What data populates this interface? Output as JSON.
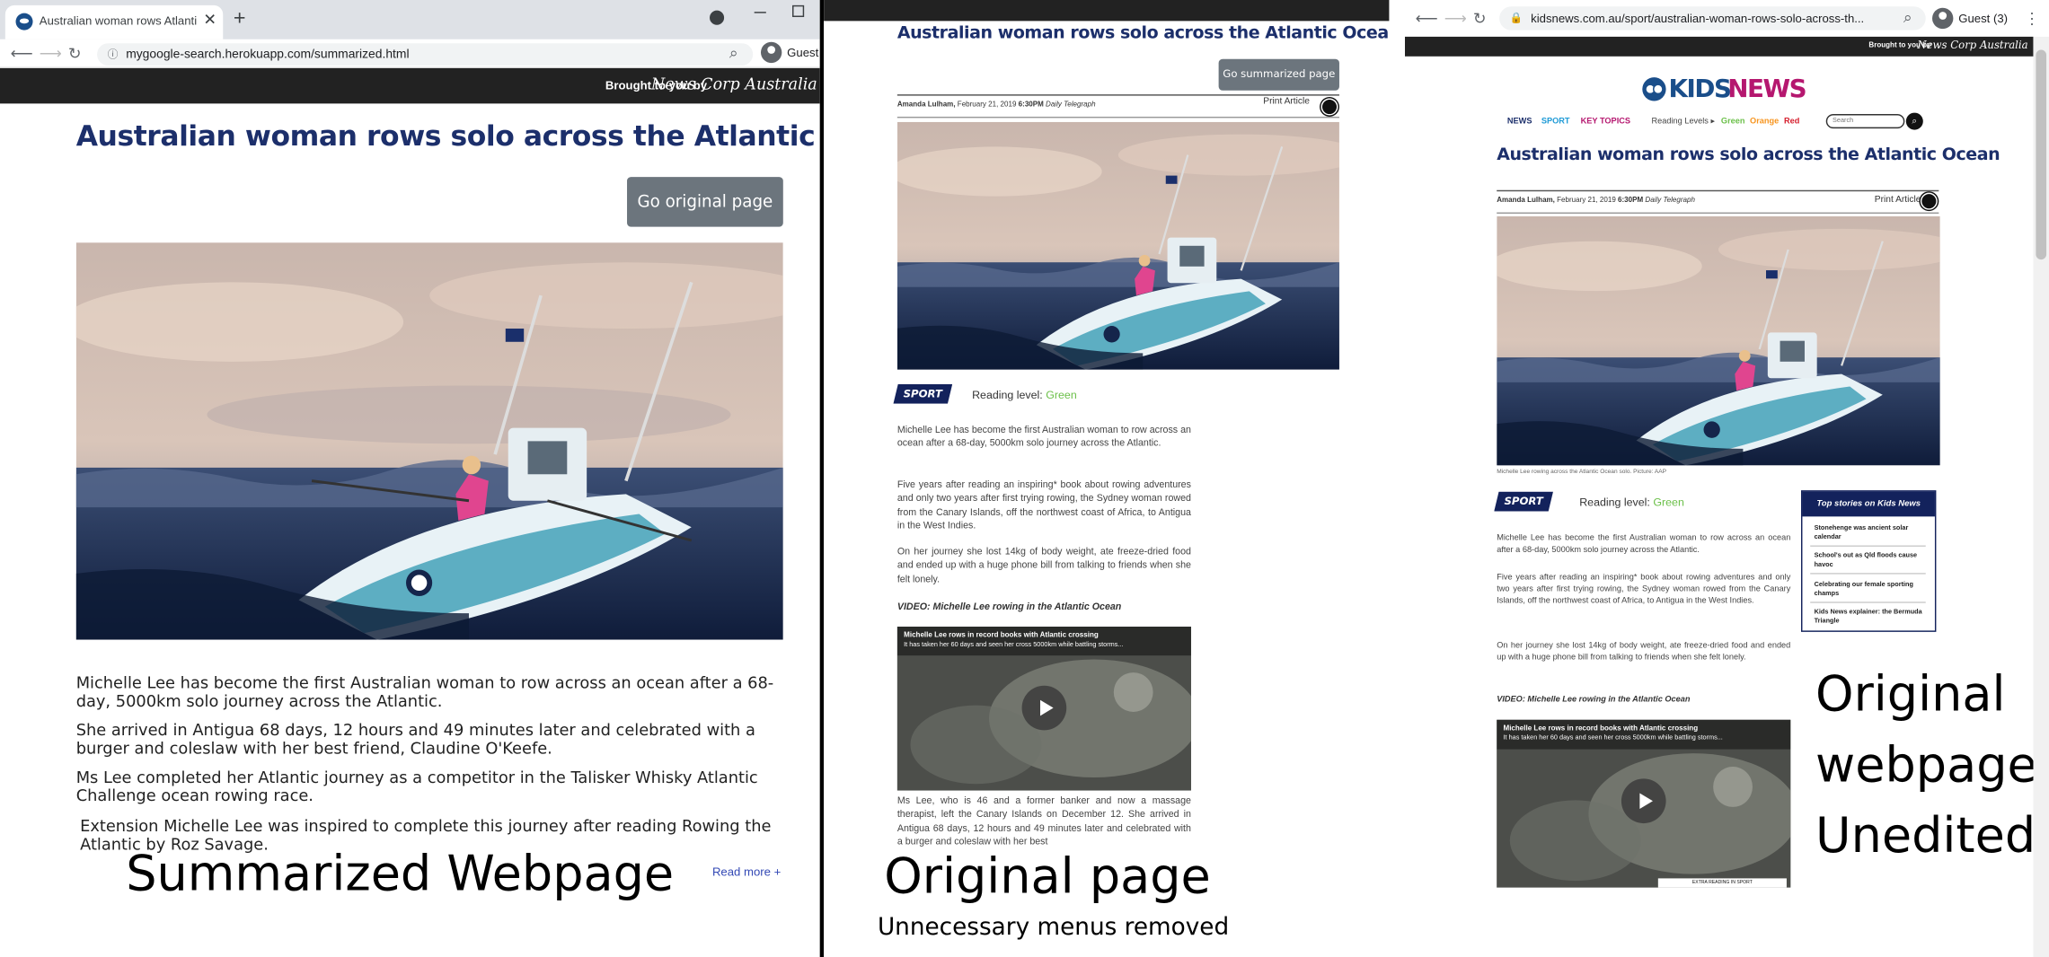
{
  "panel1": {
    "tab_title": "Australian woman rows Atlantic |",
    "tab_close": "✕",
    "new_tab": "+",
    "url": "mygoogle-search.herokuapp.com/summarized.html",
    "profile": "Guest",
    "brought_to_you": "Brought to you by",
    "brand_logo": "News Corp Australia",
    "headline": "Australian woman rows solo across the Atlantic Ocean",
    "button": "Go original page",
    "paragraphs": [
      "Michelle Lee has become the first Australian woman to row across an ocean after a 68-day, 5000km solo journey across the Atlantic.",
      "She arrived in Antigua 68 days, 12 hours and 49 minutes later and celebrated with a burger and coleslaw with her best friend, Claudine O'Keefe.",
      "Ms Lee completed her Atlantic journey as a competitor in the Talisker Whisky Atlantic Challenge ocean rowing race.",
      "Extension Michelle Lee was inspired to complete this journey after reading Rowing the Atlantic by Roz Savage."
    ],
    "read_more": "Read more +",
    "label": "Summarized Webpage"
  },
  "panel2": {
    "headline": "Australian woman rows solo across the Atlantic Ocean",
    "button": "Go summarized page",
    "author": "Amanda Lulham,",
    "date": "February 21, 2019",
    "time": "6:30PM",
    "publication": "Daily Telegraph",
    "print": "Print Article",
    "category": "SPORT",
    "reading_level_label": "Reading level:",
    "reading_level": "Green",
    "paragraphs": [
      "Michelle Lee has become the first Australian woman to row across an ocean after a 68-day, 5000km solo journey across the Atlantic.",
      "Five years after reading an inspiring* book about rowing adventures and only two years after first trying rowing, the Sydney woman rowed from the Canary Islands, off the northwest coast of Africa, to Antigua in the West Indies.",
      "On her journey she lost 14kg of body weight, ate freeze-dried food and ended up with a huge phone bill from talking to friends when she felt lonely."
    ],
    "video_heading": "VIDEO: Michelle Lee rowing in the Atlantic Ocean",
    "video_title": "Michelle Lee rows in record books with Atlantic crossing",
    "video_sub": "It has taken her 60 days and seen her cross 5000km while battling storms...",
    "after_video": "Ms Lee, who is 46 and a former banker and now a massage therapist, left the Canary Islands on December 12. She arrived in Antigua 68 days, 12 hours and 49 minutes later and celebrated with a burger and coleslaw with her best",
    "label": "Original page",
    "sublabel": "Unnecessary menus removed"
  },
  "panel3": {
    "url": "kidsnews.com.au/sport/australian-woman-rows-solo-across-th...",
    "profile": "Guest (3)",
    "brought_to_you": "Brought to you by",
    "brand_logo": "News Corp Australia",
    "logo_kids": "KIDS",
    "logo_news": "NEWS",
    "nav": [
      "NEWS",
      "SPORT",
      "KEY TOPICS"
    ],
    "reading_levels_label": "Reading Levels ▸",
    "levels": [
      "Green",
      "Orange",
      "Red"
    ],
    "search_placeholder": "Search",
    "headline": "Australian woman rows solo across the Atlantic Ocean",
    "author": "Amanda Lulham,",
    "date": "February 21, 2019",
    "time": "6:30PM",
    "publication": "Daily Telegraph",
    "print": "Print Article",
    "photo_caption": "Michelle Lee rowing across the Atlantic Ocean solo. Picture: AAP",
    "category": "SPORT",
    "reading_level_label": "Reading level:",
    "reading_level": "Green",
    "paragraphs": [
      "Michelle Lee has become the first Australian woman to row across an ocean after a 68-day, 5000km solo journey across the Atlantic.",
      "Five years after reading an inspiring* book about rowing adventures and only two years after first trying rowing, the Sydney woman rowed from the Canary Islands, off the northwest coast of Africa, to Antigua in the West Indies.",
      "On her journey she lost 14kg of body weight, ate freeze-dried food and ended up with a huge phone bill from talking to friends when she felt lonely."
    ],
    "video_heading": "VIDEO: Michelle Lee rowing in the Atlantic Ocean",
    "video_title": "Michelle Lee rows in record books with Atlantic crossing",
    "video_sub": "It has taken her 60 days and seen her cross 5000km while battling storms...",
    "video_footer": "EXTRA READING IN SPORT",
    "top_stories_title": "Top stories on Kids News",
    "top_stories": [
      "Stonehenge was ancient solar calendar",
      "School's out as Qld floods cause havoc",
      "Celebrating our female sporting champs",
      "Kids News explainer: the Bermuda Triangle"
    ],
    "label_lines": [
      "Original",
      "webpage",
      "Unedited"
    ]
  },
  "colors": {
    "headline_navy": "#1c2f6b",
    "reading_green": "#6cc04a",
    "orange": "#f7941d",
    "red": "#d6202f",
    "kids_blue": "#1a4e8a",
    "news_magenta": "#b5176f",
    "button_gray": "#6c757d"
  }
}
